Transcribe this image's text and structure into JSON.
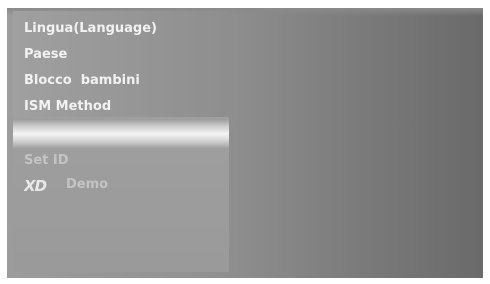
{
  "menu": {
    "items": [
      {
        "label": "Lingua(Language)"
      },
      {
        "label": "Paese"
      },
      {
        "label": "Blocco  bambini"
      },
      {
        "label": "ISM Method"
      }
    ],
    "disabled_items": [
      {
        "label": "Set ID"
      },
      {
        "label": "Demo",
        "logo_text": "XD"
      }
    ]
  },
  "colors": {
    "text_active": "#f2f2f2",
    "text_disabled": "#c4c4c4",
    "highlight": "#f4f4f4",
    "panel": "#9c9c9c"
  }
}
